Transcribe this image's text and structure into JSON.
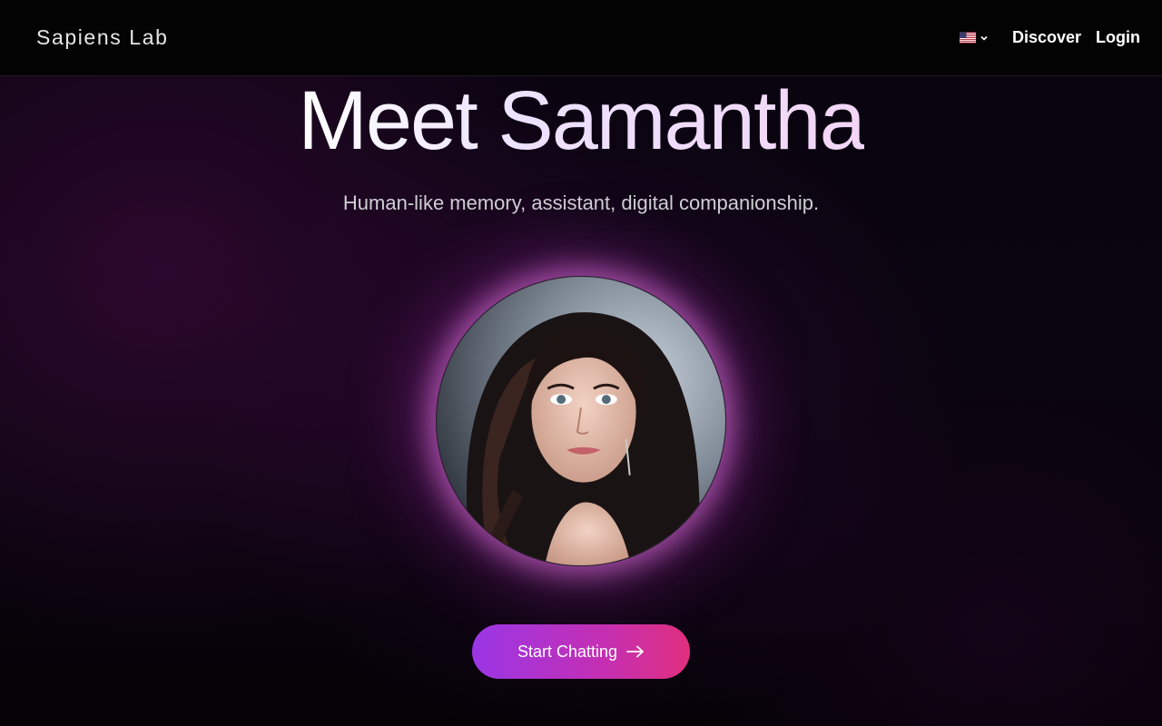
{
  "header": {
    "brand": "Sapiens Lab",
    "language": {
      "icon": "us-flag-icon",
      "selected": "English (US)"
    },
    "nav": {
      "discover": "Discover",
      "login": "Login"
    }
  },
  "hero": {
    "title": "Meet Samantha",
    "subtitle": "Human-like memory, assistant, digital companionship.",
    "avatar_alt": "Samantha portrait",
    "cta_label": "Start Chatting",
    "cta_icon": "arrow-right-icon"
  },
  "colors": {
    "background": "#000000",
    "glow": "#e978e6",
    "cta_gradient_start": "#9a36e6",
    "cta_gradient_end": "#e02f7e"
  }
}
